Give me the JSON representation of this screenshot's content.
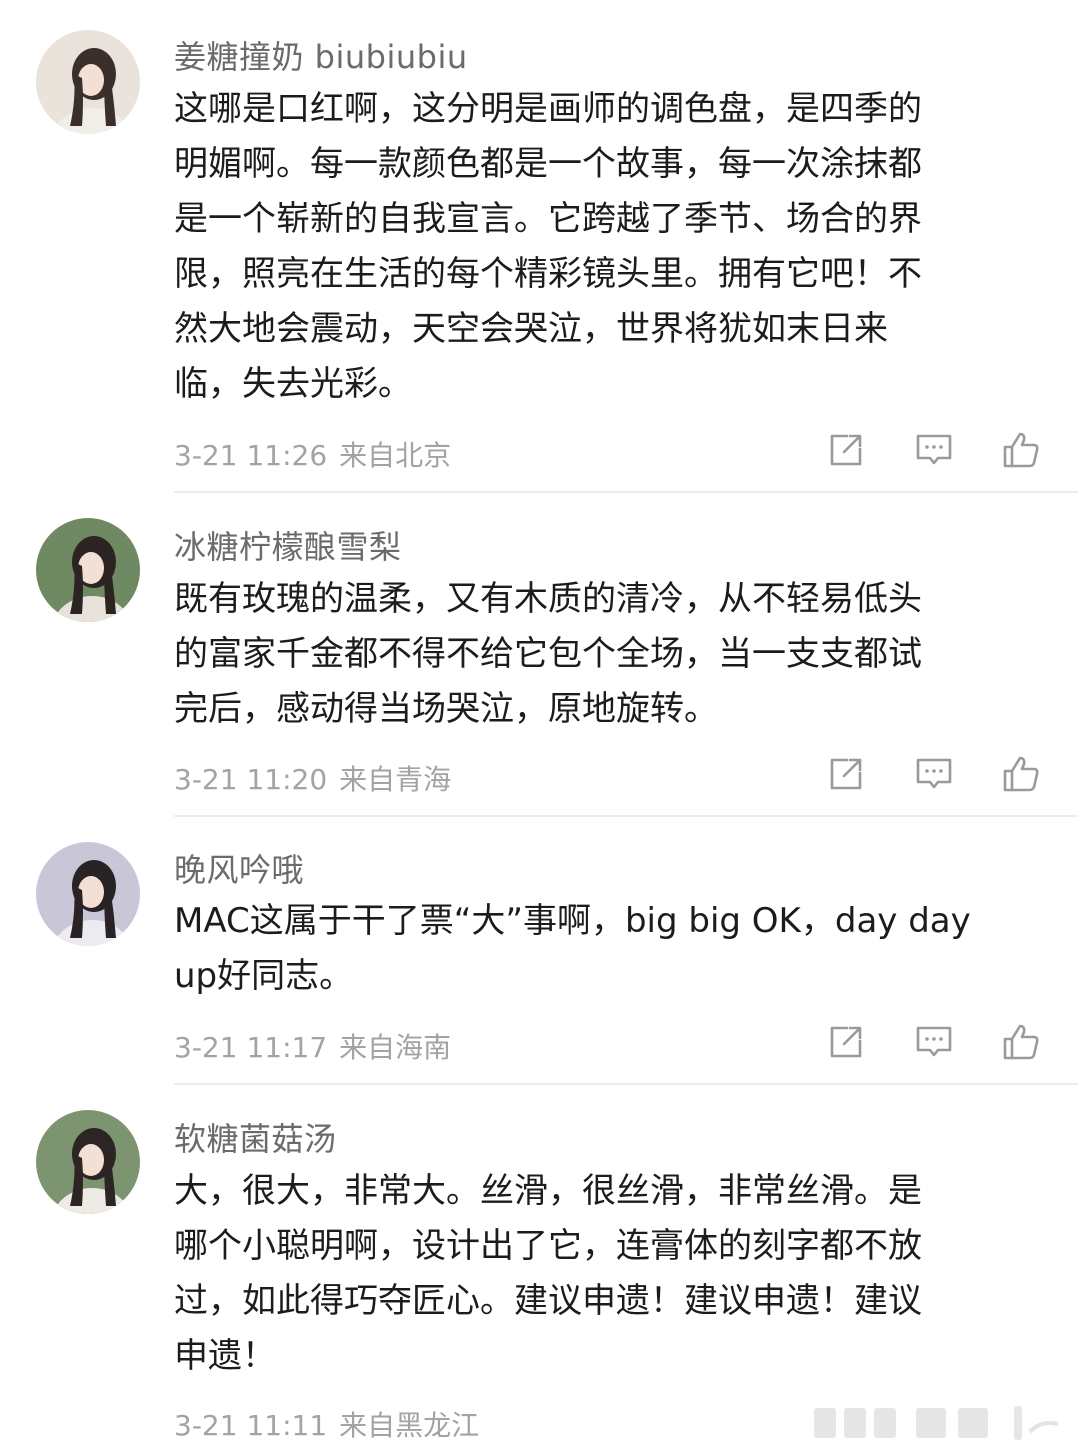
{
  "comments": [
    {
      "username": "姜糖撞奶 biubiubiu",
      "lines": [
        "这哪是口红啊，这分明是画师的调色盘，是四季的",
        "明媚啊。每一款颜色都是一个故事，每一次涂抹都",
        "是一个崭新的自我宣言。它跨越了季节、场合的界",
        "限，照亮在生活的每个精彩镜头里。拥有它吧！不",
        "然大地会震动，天空会哭泣，世界将犹如末日来",
        "临，失去光彩。"
      ],
      "time": "3-21 11:26",
      "location": "来自北京",
      "avatar_colors": [
        "#e9e3dc",
        "#3b2f2c",
        "#f1ede8"
      ]
    },
    {
      "username": "冰糖柠檬酿雪梨",
      "lines": [
        "既有玫瑰的温柔，又有木质的清冷，从不轻易低头",
        "的富家千金都不得不给它包个全场，当一支支都试",
        "完后，感动得当场哭泣，原地旋转。"
      ],
      "time": "3-21 11:20",
      "location": "来自青海",
      "avatar_colors": [
        "#6f8a63",
        "#2b2422",
        "#e8e2da"
      ]
    },
    {
      "username": "晚风吟哦",
      "lines": [
        "MAC这属于干了票“大”事啊，big big OK，day day",
        "up好同志。"
      ],
      "time": "3-21 11:17",
      "location": "来自海南",
      "avatar_colors": [
        "#c9c6d8",
        "#2a2325",
        "#ecebf2"
      ]
    },
    {
      "username": "软糖菌菇汤",
      "lines": [
        "大，很大，非常大。丝滑，很丝滑，非常丝滑。是",
        "哪个小聪明啊，设计出了它，连膏体的刻字都不放",
        "过，如此得巧夺匠心。建议申遗！建议申遗！建议",
        "申遗！"
      ],
      "time": "3-21 11:11",
      "location": "来自黑龙江",
      "avatar_colors": [
        "#7c9470",
        "#2c2523",
        "#eeeae4"
      ]
    }
  ],
  "icons": {
    "share": "share-icon",
    "comment": "comment-icon",
    "like": "like-icon"
  },
  "colors": {
    "username": "#6b6b6b",
    "text": "#1c1c1c",
    "meta": "#a3a3a3",
    "icon": "#9a9a9a",
    "divider": "#ececec"
  }
}
